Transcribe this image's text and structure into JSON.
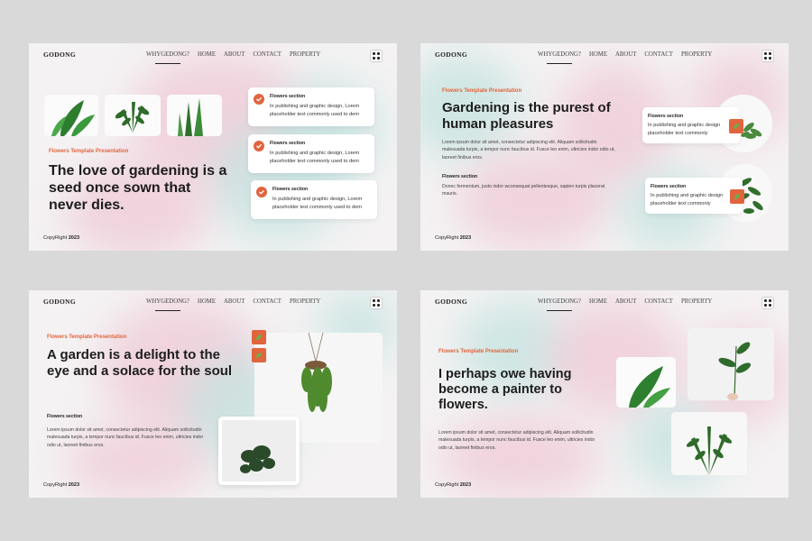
{
  "common": {
    "logo": "GODONG",
    "nav": [
      "WHYGEDONG?",
      "HOME",
      "ABOUT",
      "CONTACT",
      "PROPERTY"
    ],
    "copyright_prefix": "CopyRight",
    "copyright_year": "2023",
    "menu_icon": "grid-icon"
  },
  "slide1": {
    "eyebrow": "Flowers  Template Presentation",
    "headline": "The love of gardening is a seed once sown that never dies.",
    "cards": [
      {
        "title": "Flowers section",
        "text": "In publishing and graphic design, Lorem placeholder text commonly used to dem"
      },
      {
        "title": "Flowers section",
        "text": "In publishing and graphic design, Lorem placeholder text commonly used to dem"
      },
      {
        "title": "Flowers section",
        "text": "In publishing and graphic design, Lorem placeholder text commonly used to dem"
      }
    ]
  },
  "slide2": {
    "eyebrow": "Flowers  Template Presentation",
    "headline": "Gardening is the purest of human pleasures",
    "body": "Lorem ipsum dolor sit amet, consectetur adipiscing elit. Aliquam sollicitudin malesuada turpis, a tempor nunc faucibus id. Fusce leo enim, ultricies indor odio ut, laoreet finibus eros.",
    "section_title": "Flowers section",
    "section_body": "Donec fermentum, justo indor wconsequat pellentesque, sapien turpis placerat mauris.",
    "cards": [
      {
        "title": "Flowers section",
        "text": "In publishing and graphic design placeholder text commonly"
      },
      {
        "title": "Flowers section",
        "text": "In publishing and graphic design placeholder text commonly"
      }
    ]
  },
  "slide3": {
    "eyebrow": "Flowers  Template Presentation",
    "headline": "A garden is a delight to the eye and a solace for the soul",
    "section_title": "Flowers section",
    "body": "Lorem ipsum dolor sit amet, consectetur adipiscing elit. Aliquam sollicitudin malesuada turpis, a tempor nunc faucibus id. Fusce leo enim, ultricies indor odio ut, laoreet finibus eros."
  },
  "slide4": {
    "eyebrow": "Flowers  Template Presentation",
    "headline": "I perhaps owe having become a painter to flowers.",
    "body": "Lorem ipsum dolor sit amet, consectetur adipiscing elit. Aliquam sollicitudin malesuada turpis, a tempor nunc faucibus id. Fusce leo enim, ultricies indor odio ut, laoreet finibus eros."
  },
  "colors": {
    "accent": "#e0653e",
    "pink": "#efc9d6",
    "teal": "#c3e3df",
    "background": "#f4f2f3"
  }
}
